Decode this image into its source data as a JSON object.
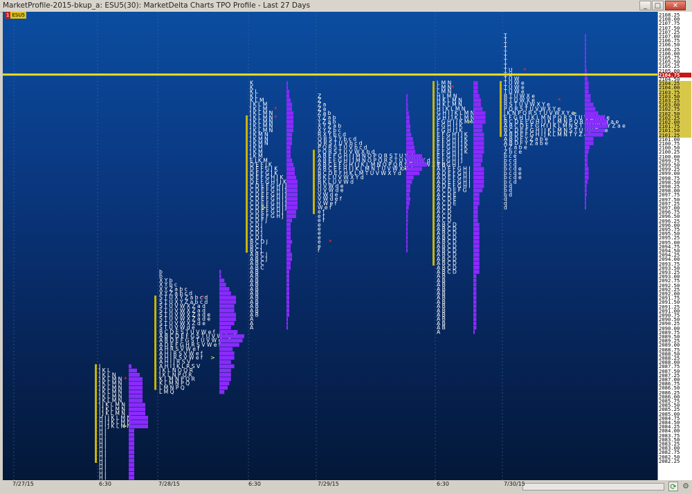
{
  "window": {
    "title": "MarketProfile-2015-bkup_a: ESU5(30): MarketDelta Charts TPO Profile - Last 27 Days",
    "symbol_tag": "ESU5",
    "symbol_badge": "1"
  },
  "colors": {
    "tpo_text": "#ffffff",
    "histogram": "#8a2bff",
    "value_area": "#c8b400",
    "current_price_line": "#f0e020",
    "poc_star": "#ff2a2a",
    "arrow": "#ffff66"
  },
  "price_axis": {
    "labels": [
      "2108.25",
      "2108.00",
      "2107.75",
      "2107.50",
      "2107.25",
      "2107.00",
      "2106.75",
      "2106.50",
      "2106.25",
      "2106.00",
      "2105.75",
      "2105.50",
      "2105.25",
      "2105.00",
      "2104.75",
      "2104.50",
      "2104.25",
      "2104.00",
      "2103.75",
      "2103.50",
      "2103.25",
      "2103.00",
      "2102.75",
      "2102.50",
      "2102.25",
      "2102.00",
      "2101.75",
      "2101.50",
      "2101.25",
      "2101.00",
      "2100.75",
      "2100.50",
      "2100.25",
      "2100.00",
      "2099.75",
      "2099.50",
      "2099.25",
      "2099.00",
      "2098.75",
      "2098.50",
      "2098.25",
      "2098.00",
      "2097.75",
      "2097.50",
      "2097.25",
      "2097.00",
      "2096.75",
      "2096.50",
      "2096.25",
      "2096.00",
      "2095.75",
      "2095.50",
      "2095.25",
      "2095.00",
      "2094.75",
      "2094.50",
      "2094.25",
      "2094.00",
      "2093.75",
      "2093.50",
      "2093.25",
      "2093.00",
      "2092.75",
      "2092.50",
      "2092.25",
      "2092.00",
      "2091.75",
      "2091.50",
      "2091.25",
      "2091.00",
      "2090.75",
      "2090.50",
      "2090.25",
      "2090.00",
      "2089.75",
      "2089.50",
      "2089.25",
      "2089.00",
      "2088.75",
      "2088.50",
      "2088.25",
      "2088.00",
      "2087.75",
      "2087.50",
      "2087.25",
      "2087.00",
      "2086.75",
      "2086.50",
      "2086.25",
      "2086.00",
      "2085.75",
      "2085.50",
      "2085.25",
      "2085.00",
      "2084.75",
      "2084.50",
      "2084.25",
      "2084.00",
      "2083.75",
      "2083.50",
      "2083.25",
      "2083.00",
      "2082.75",
      "2082.50",
      "2082.25"
    ],
    "current_price": "2104.75",
    "value_area_range": [
      "2104.25",
      "2101.25"
    ]
  },
  "time_axis": {
    "labels": [
      "7/27/15",
      "6:30",
      "7/28/15",
      "6:30",
      "7/29/15",
      "6:30",
      "7/30/15"
    ]
  },
  "profiles": [
    {
      "rows": [
        "J",
        "J K L",
        "J K L N",
        "J K L M N",
        "J K L M N",
        "J K L M N",
        "J K L M N",
        "J K L M N",
        "J K L M N",
        "I J K L M N",
        "I J K L M N",
        "I J K L M N",
        "H I J K L M N",
        "H I J K L M N",
        "H I J K L M N",
        "H I",
        "H I",
        "H I",
        "H I",
        "H I",
        "H I",
        "H I",
        "H I",
        "H I",
        "H I",
        "H I",
        "H I",
        "H I",
        "H"
      ]
    },
    {
      "rows": [
        "b",
        "b",
        "X Y b",
        "X Y b c",
        "X Y Z a b c",
        "X Y Z a b c d",
        "S T U X Y Z a b c d",
        "S T U X Y Z a b c d",
        "S T U V W X Z a d",
        "S T U V W X Z a d",
        "S T U V W X Z a d e",
        "S T U V W X Z a d e",
        "S T U V W X Z d e",
        "S T U V W d e",
        "B C D E S T U V W e f",
        "A B C D E F G S T U V W d e f",
        "A B D E F G S T U V W d e f",
        "A D E F G H R S V W e f",
        "A H R S V W e f",
        "A H I R S V W e f",
        "A H I R S V W e f",
        "A H I J R S V",
        "A H I J K L R S V",
        "J K L N O Q R",
        "J K L N P Q R",
        "K L M N P Q R",
        "K L M N P Q",
        "L M N P Q",
        "L M Q"
      ]
    },
    {
      "rows": [
        "K",
        "K",
        "K L",
        "K L",
        "K L M",
        "J K L M",
        "J K L M",
        "J K L M N",
        "J K L M N",
        "J K L M N",
        "J K L M N",
        "J K L M N",
        "J K M N",
        "J K M N",
        "J K M N",
        "J K M",
        "J K M",
        "J K M",
        "E J K M",
        "D E F J K",
        "D E F G J K",
        "D E F G J K",
        "D E F G H J K",
        "D E F G H I J K",
        "C D E F G H I J",
        "C D E F G H I J",
        "C D E F G H I J",
        "C D E F G H I J",
        "C D E F G H I J",
        "C D E F G H I J",
        "C D E F G H J",
        "C D E F G H J",
        "C D F J",
        "C D J",
        "C D J",
        "C D J",
        "C D J",
        "B C D J",
        "B C J",
        "B C J",
        "A B C J",
        "A B C J",
        "A B C",
        "A B C",
        "A B",
        "A B",
        "A B",
        "A B",
        "A B",
        "A B",
        "A B",
        "A B",
        "A B",
        "A B",
        "A B",
        "A",
        "A",
        "A"
      ]
    },
    {
      "rows": [
        "Z",
        "Z",
        "Z a",
        "Z a",
        "Z a b",
        "Y Z a b",
        "Y Z a b",
        "X Y Z a b",
        "X Y Z b c",
        "R X Y b c d",
        "Q R S T Y b c d",
        "Q R S T U V b c d",
        "P Q R S T U V b c d",
        "P Q R S T U V W X b d",
        "A B E F G H I J M N O P Q R S T U Y d",
        "A B E F G H I J M N O P Q R S T U V W X Y d",
        "A B C E F G H I J K L M N O P Q R S T U V W X Y d",
        "A B C E F H I J K L M N T U V W X Y d",
        "B C D E F H K L M T U V W X Y d",
        "B K L U V W X Y d",
        "B K L U V W d",
        "U V W d e",
        "U V W d e",
        "V W d e",
        "V W d e f",
        "V W e f",
        "W e f",
        "e f",
        "e f",
        "e f",
        "e",
        "e",
        "e",
        "e",
        "e",
        "e",
        "f"
      ]
    },
    {
      "rows": [
        "L M N",
        "L M N",
        "L M N",
        "H L M N",
        "H K L M N",
        "H K L M N",
        "H I K L M N",
        "G H I J K L M N",
        "G H I J K L M N",
        "F G H I J K M N",
        "F G H I J K",
        "F G H I J K",
        "E F G H I J K",
        "E F G H I J K",
        "E F G H I J K",
        "E F G H I J K",
        "E F G H I J K",
        "E F G H I J",
        "E F G H I J",
        "E F G H I",
        "A D E F G H I",
        "A D E F G H I",
        "A D E F G H I",
        "A D E F G H I",
        "A D E F G H I",
        "A C D E F G",
        "A C D E",
        "A C D E",
        "A C D E",
        "A C D",
        "A C D",
        "A C D",
        "A C D",
        "A B C D",
        "A B C D",
        "A B C D",
        "A B C D",
        "A B C D",
        "A B C D",
        "A B C D",
        "A B C D",
        "A B C D",
        "A B C D",
        "A B C D",
        "A B C D",
        "A B",
        "A B",
        "A B",
        "A B",
        "A B",
        "A B",
        "A B",
        "A B",
        "A B",
        "A B",
        "A B",
        "A B",
        "A B",
        "A"
      ]
    },
    {
      "rows": [
        "T",
        "T",
        "T",
        "T",
        "T",
        "T",
        "T",
        "T",
        "T U",
        "T U",
        "T U W",
        "T U W e",
        "T U W e",
        "T U W e",
        "R T U W X e",
        "R T U W X e",
        "R S T U V W X Y e",
        "P Q R S T U V W X Y e",
        "J K N P Q R S T U V W X Y e",
        "E F G H I J K L M N P Q R S T U V W X Y e",
        "B C D E F G H I J K L M N P Q R S T U V Y a e",
        "A B C D E F G H I J K L M N S T U V W X Y Z a e",
        "B C D E F G H I J K L M N S T U V Y Z a e",
        "A B D E F G H I J K L M N T Y Z a b e",
        "A B D F Y Z a b e",
        "A B D F Y Z a b e",
        "Y Z a b e",
        "Z b c e",
        "b c e",
        "b c d",
        "b c d",
        "b c d e",
        "b c d e",
        "b c d e",
        "b c d",
        "b d",
        "b d",
        "b d",
        "d",
        "d",
        "d"
      ]
    }
  ]
}
